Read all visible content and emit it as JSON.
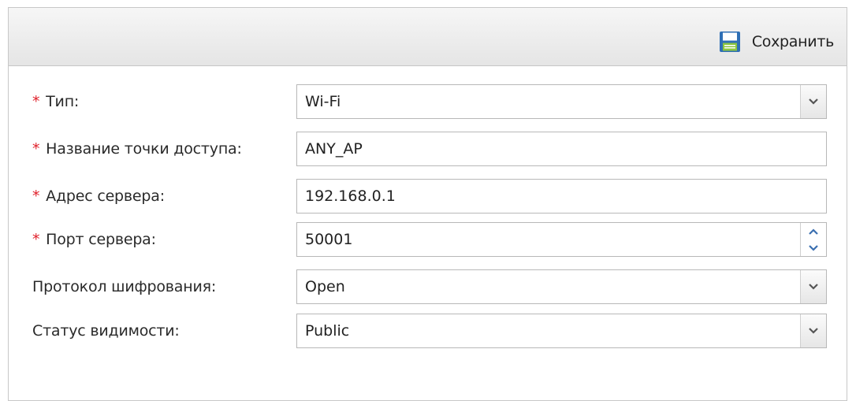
{
  "toolbar": {
    "save_label": "Сохранить",
    "save_icon": "floppy-disk-icon"
  },
  "colors": {
    "required_marker": "#e0202a",
    "toolbar_bg": "#ececec",
    "field_border": "#b8b8b8",
    "icon_blue": "#2f6fb5",
    "icon_green": "#8dc63f"
  },
  "form": {
    "required_marker": "*",
    "type": {
      "label": "Тип:",
      "value": "Wi-Fi"
    },
    "ap_name": {
      "label": "Название точки доступа:",
      "value": "ANY_AP"
    },
    "server_address": {
      "label": "Адрес сервера:",
      "value": "192.168.0.1"
    },
    "server_port": {
      "label": "Порт сервера:",
      "value": "50001"
    },
    "encryption": {
      "label": "Протокол шифрования:",
      "value": "Open"
    },
    "visibility": {
      "label": "Статус видимости:",
      "value": "Public"
    }
  }
}
